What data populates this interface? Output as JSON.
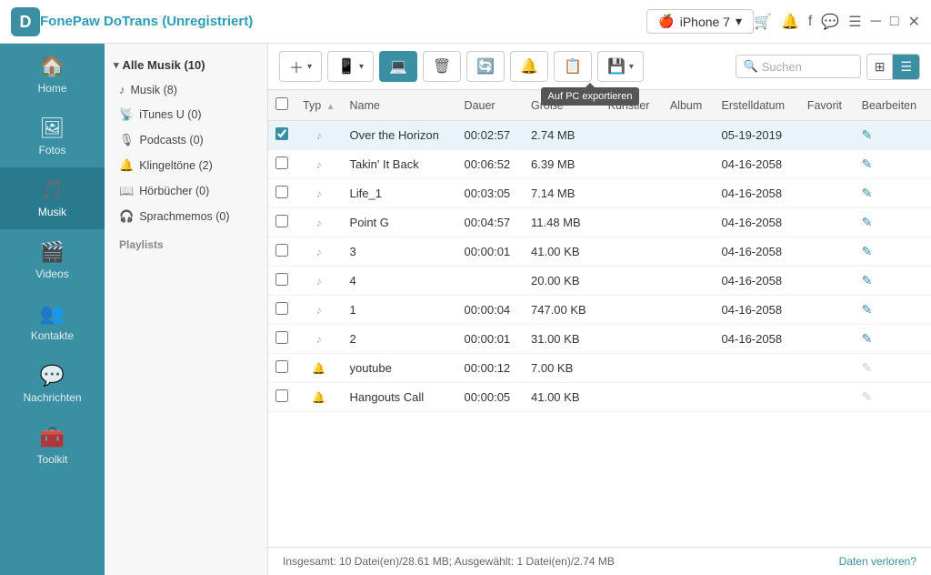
{
  "titleBar": {
    "appName": "FonePaw DoTrans (Unregistriert)",
    "device": "iPhone 7",
    "actions": [
      "cart",
      "bell",
      "facebook",
      "message",
      "menu",
      "minimize",
      "maximize",
      "close"
    ]
  },
  "sidebar": {
    "items": [
      {
        "id": "home",
        "label": "Home",
        "icon": "🏠"
      },
      {
        "id": "fotos",
        "label": "Fotos",
        "icon": "👤"
      },
      {
        "id": "musik",
        "label": "Musik",
        "icon": "🎵",
        "active": true
      },
      {
        "id": "videos",
        "label": "Videos",
        "icon": "🎬"
      },
      {
        "id": "kontakte",
        "label": "Kontakte",
        "icon": "👥"
      },
      {
        "id": "nachrichten",
        "label": "Nachrichten",
        "icon": "💬"
      },
      {
        "id": "toolkit",
        "label": "Toolkit",
        "icon": "🧰"
      }
    ]
  },
  "leftPanel": {
    "header": "Alle Musik (10)",
    "items": [
      {
        "label": "Musik (8)",
        "icon": "♪"
      },
      {
        "label": "iTunes U (0)",
        "icon": "📡"
      },
      {
        "label": "Podcasts (0)",
        "icon": "🎙"
      },
      {
        "label": "Klingeltöne (2)",
        "icon": "🔔"
      },
      {
        "label": "Hörbücher (0)",
        "icon": "📖"
      },
      {
        "label": "Sprachmemos (0)",
        "icon": "🎧"
      }
    ],
    "section": "Playlists"
  },
  "toolbar": {
    "addLabel": "+",
    "deviceBtn": "📱",
    "exportBtn": "💻",
    "deleteBtn": "🗑",
    "syncBtn": "🔄",
    "bellBtn": "🔔",
    "copyBtn": "📋",
    "moreBtn": "💾",
    "searchPlaceholder": "Suchen",
    "gridBtn": "⊞",
    "listBtn": "☰",
    "tooltip": "Auf PC exportieren"
  },
  "table": {
    "headers": [
      "",
      "Typ",
      "Name",
      "Dauer",
      "Größe",
      "Künstler",
      "Album",
      "Erstelldatum",
      "Favorit",
      "Bearbeiten"
    ],
    "rows": [
      {
        "checked": true,
        "type": "music",
        "name": "Over the Horizon",
        "dauer": "00:02:57",
        "groesse": "2.74 MB",
        "kuenstler": "",
        "album": "",
        "erstelldatum": "05-19-2019",
        "favorit": "",
        "selected": true
      },
      {
        "checked": false,
        "type": "music",
        "name": "Takin' It Back",
        "dauer": "00:06:52",
        "groesse": "6.39 MB",
        "kuenstler": "",
        "album": "",
        "erstelldatum": "04-16-2058",
        "favorit": "",
        "selected": false
      },
      {
        "checked": false,
        "type": "music",
        "name": "Life_1",
        "dauer": "00:03:05",
        "groesse": "7.14 MB",
        "kuenstler": "",
        "album": "",
        "erstelldatum": "04-16-2058",
        "favorit": "",
        "selected": false
      },
      {
        "checked": false,
        "type": "music",
        "name": "Point G",
        "dauer": "00:04:57",
        "groesse": "11.48 MB",
        "kuenstler": "",
        "album": "",
        "erstelldatum": "04-16-2058",
        "favorit": "",
        "selected": false
      },
      {
        "checked": false,
        "type": "music",
        "name": "3",
        "dauer": "00:00:01",
        "groesse": "41.00 KB",
        "kuenstler": "",
        "album": "",
        "erstelldatum": "04-16-2058",
        "favorit": "",
        "selected": false
      },
      {
        "checked": false,
        "type": "music",
        "name": "4",
        "dauer": "",
        "groesse": "20.00 KB",
        "kuenstler": "",
        "album": "",
        "erstelldatum": "04-16-2058",
        "favorit": "",
        "selected": false
      },
      {
        "checked": false,
        "type": "music",
        "name": "1",
        "dauer": "00:00:04",
        "groesse": "747.00 KB",
        "kuenstler": "",
        "album": "",
        "erstelldatum": "04-16-2058",
        "favorit": "",
        "selected": false
      },
      {
        "checked": false,
        "type": "music",
        "name": "2",
        "dauer": "00:00:01",
        "groesse": "31.00 KB",
        "kuenstler": "",
        "album": "",
        "erstelldatum": "04-16-2058",
        "favorit": "",
        "selected": false,
        "editActive": true
      },
      {
        "checked": false,
        "type": "ringtone",
        "name": "youtube",
        "dauer": "00:00:12",
        "groesse": "7.00 KB",
        "kuenstler": "",
        "album": "",
        "erstelldatum": "",
        "favorit": "",
        "selected": false
      },
      {
        "checked": false,
        "type": "ringtone",
        "name": "Hangouts Call",
        "dauer": "00:00:05",
        "groesse": "41.00 KB",
        "kuenstler": "",
        "album": "",
        "erstelldatum": "",
        "favorit": "",
        "selected": false
      }
    ]
  },
  "statusBar": {
    "summary": "Insgesamt: 10 Datei(en)/28.61 MB; Ausgewählt: 1 Datei(en)/2.74 MB",
    "link": "Daten verloren?"
  }
}
